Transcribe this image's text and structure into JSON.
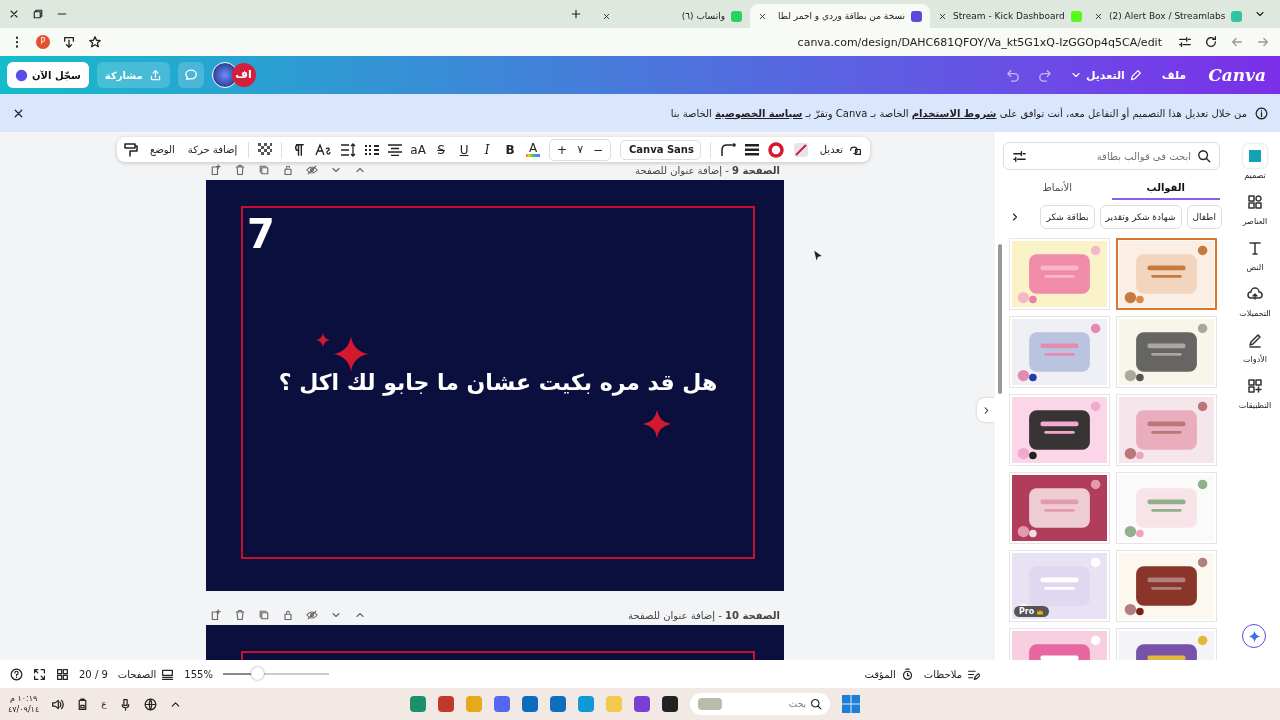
{
  "browser": {
    "tabs": [
      {
        "title": "(2) Alert Box / Streamlabs",
        "selected": false
      },
      {
        "title": "Stream - Kick Dashboard",
        "selected": false
      },
      {
        "title": "نسخة من بطاقة وردي و احمر لطا",
        "selected": true
      },
      {
        "title": "(٦) واتساب",
        "selected": false
      }
    ],
    "profile": "P",
    "url": "canva.com/design/DAHC681QFOY/Va_kt5G1xQ-IzGGOp4q5CA/edit"
  },
  "header": {
    "signup": "سجّل الآن",
    "share": "مشاركة",
    "avatar": "اف",
    "logo": "Canva",
    "file": "ملف",
    "edit": "التعديل"
  },
  "notice": "من خلال تعديل هذا التصميم أو التفاعل معه، أنت توافق على **شروط الاستخدام** الخاصة بـ Canva وتقرّ بـ **سياسة الخصوصية** الخاصة بنا",
  "toolbar": {
    "position": "الوضع",
    "animate": "إضافة حركة",
    "case": "aA",
    "strike": "S",
    "underline": "U",
    "italic": "I",
    "bold": "B",
    "color_letter": "A",
    "size_plus": "+",
    "font_size": "٧",
    "size_minus": "−",
    "font": "Canva Sans",
    "edit": "تعديل"
  },
  "pages": [
    {
      "number": "الصفحة 9",
      "title": "- إضافة عنوان للصفحة",
      "slide_number": "7",
      "question": "هل قد مره بكيت عشان ما جابو لك اكل ؟"
    },
    {
      "number": "الصفحة 10",
      "title": "- إضافة عنوان للصفحة"
    }
  ],
  "panel": {
    "search": {
      "placeholder": "ابحث في قوالب بطاقة"
    },
    "tabs": [
      {
        "label": "القوالب",
        "selected": true
      },
      {
        "label": "الأنماط",
        "selected": false
      }
    ],
    "chips": [
      "اطفال",
      "شهادة شكر وتقدير",
      "بطاقة شكر"
    ],
    "templates": [
      {
        "kind": "picture",
        "selected": true
      },
      {
        "kind": "picture",
        "selected": false
      },
      {
        "kind": "picture",
        "selected": false
      },
      {
        "kind": "picture",
        "selected": false
      },
      {
        "kind": "picture",
        "selected": false
      },
      {
        "kind": "picture",
        "selected": false
      },
      {
        "kind": "picture",
        "selected": false
      },
      {
        "kind": "picture",
        "selected": false
      },
      {
        "kind": "picture",
        "selected": false
      },
      {
        "kind": "picture",
        "selected": false,
        "badge": "Pro"
      },
      {
        "kind": "picture",
        "selected": false
      },
      {
        "kind": "picture",
        "selected": false
      }
    ]
  },
  "rail": [
    {
      "label": "تصميم",
      "selected": true
    },
    {
      "label": "العناصر",
      "selected": false
    },
    {
      "label": "النص",
      "selected": false
    },
    {
      "label": "التحميلات",
      "selected": false
    },
    {
      "label": "الأدوات",
      "selected": false
    },
    {
      "label": "التطبيقات",
      "selected": false
    }
  ],
  "footer": {
    "notes": "ملاحظات",
    "timer": "المؤقت",
    "zoom": {
      "level": 0.33,
      "reading": "155%"
    },
    "pages": "الصفحات",
    "page_count": "20 / 9"
  },
  "taskbar": {
    "search": {
      "placeholder": "بحث"
    },
    "language": "ع",
    "time": "١٠:١٩ م",
    "date": "٤٧/٠٩/١٤"
  }
}
